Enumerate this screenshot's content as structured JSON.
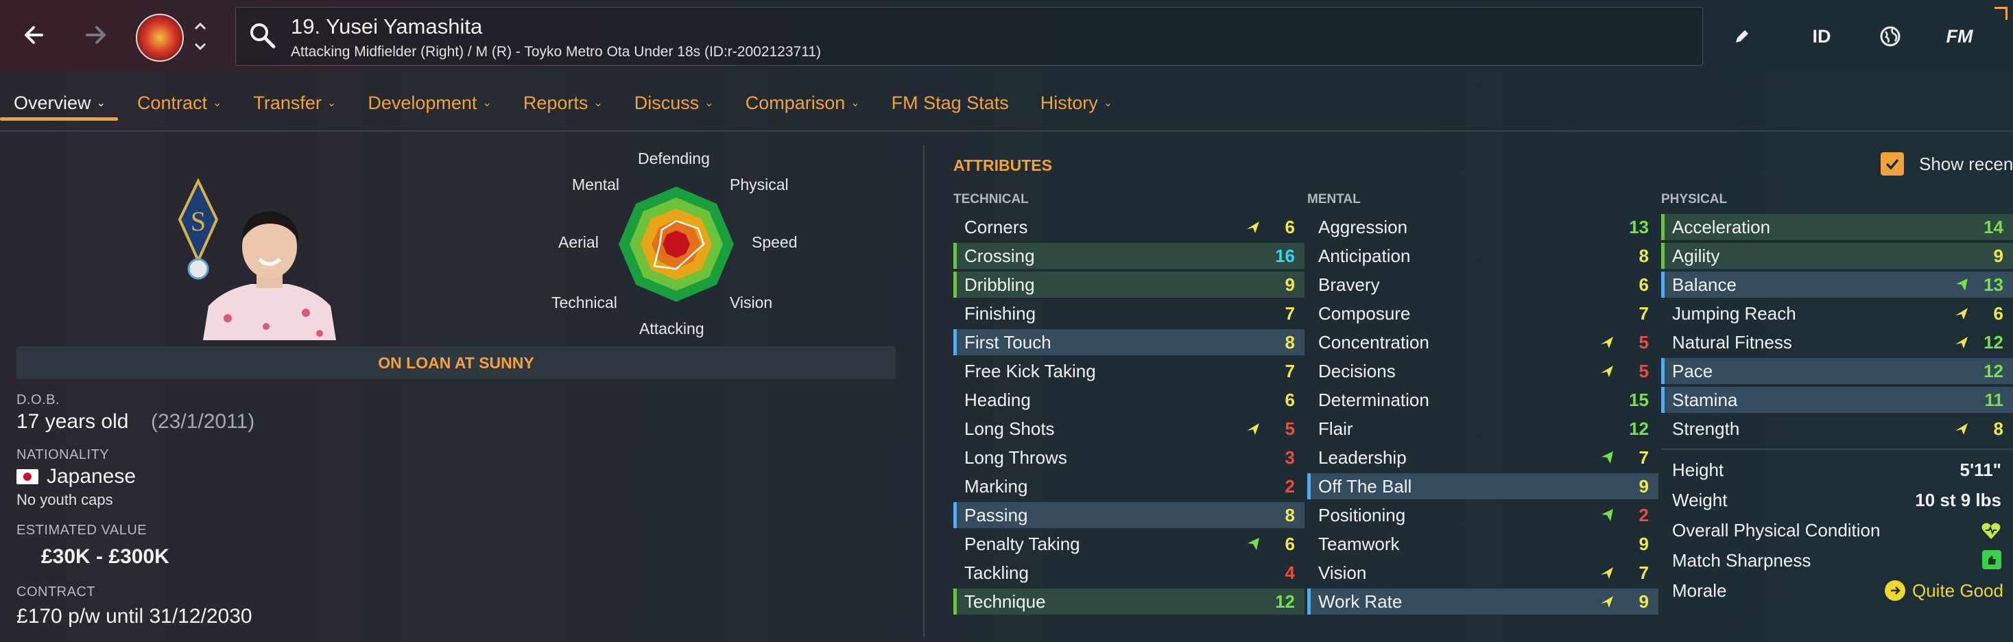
{
  "header": {
    "title": "19. Yusei Yamashita",
    "subtitle": "Attacking Midfielder (Right) / M (R) - Toyko Metro Ota Under 18s (ID:r-2002123711)",
    "icons": [
      "back-arrow-icon",
      "forward-arrow-icon",
      "club-crest-icon",
      "chevron-up-icon",
      "chevron-down-icon",
      "search-icon",
      "pencil-icon",
      "globe-icon"
    ],
    "id_label": "ID",
    "fm_label": "FM"
  },
  "tabs": [
    {
      "label": "Overview",
      "active": true,
      "dropdown": true
    },
    {
      "label": "Contract",
      "dropdown": true
    },
    {
      "label": "Transfer",
      "dropdown": true
    },
    {
      "label": "Development",
      "dropdown": true
    },
    {
      "label": "Reports",
      "dropdown": true
    },
    {
      "label": "Discuss",
      "dropdown": true
    },
    {
      "label": "Comparison",
      "dropdown": true
    },
    {
      "label": "FM Stag Stats",
      "dropdown": false
    },
    {
      "label": "History",
      "dropdown": true
    }
  ],
  "radar": {
    "labels": [
      "Defending",
      "Physical",
      "Speed",
      "Vision",
      "Attacking",
      "Technical",
      "Aerial",
      "Mental"
    ]
  },
  "profile": {
    "loan_status": "ON LOAN AT SUNNY",
    "dob_label": "D.O.B.",
    "age": "17 years old",
    "dob": "(23/1/2011)",
    "nationality_label": "NATIONALITY",
    "nationality": "Japanese",
    "youth_caps": "No youth caps",
    "value_label": "ESTIMATED VALUE",
    "value": "£30K - £300K",
    "contract_label": "CONTRACT",
    "contract": "£170 p/w until 31/12/2030"
  },
  "attributes": {
    "title": "ATTRIBUTES",
    "show_recent_label": "Show recen",
    "show_recent_checked": true,
    "technical_label": "TECHNICAL",
    "mental_label": "MENTAL",
    "physical_label": "PHYSICAL",
    "technical": [
      {
        "name": "Corners",
        "value": "6",
        "arrow": "up"
      },
      {
        "name": "Crossing",
        "value": "16",
        "hl": "green"
      },
      {
        "name": "Dribbling",
        "value": "9",
        "hl": "green"
      },
      {
        "name": "Finishing",
        "value": "7"
      },
      {
        "name": "First Touch",
        "value": "8",
        "hl": "blue"
      },
      {
        "name": "Free Kick Taking",
        "value": "7"
      },
      {
        "name": "Heading",
        "value": "6"
      },
      {
        "name": "Long Shots",
        "value": "5",
        "arrow": "up"
      },
      {
        "name": "Long Throws",
        "value": "3"
      },
      {
        "name": "Marking",
        "value": "2"
      },
      {
        "name": "Passing",
        "value": "8",
        "hl": "blue"
      },
      {
        "name": "Penalty Taking",
        "value": "6",
        "arrow": "down"
      },
      {
        "name": "Tackling",
        "value": "4"
      },
      {
        "name": "Technique",
        "value": "12",
        "hl": "green"
      }
    ],
    "mental": [
      {
        "name": "Aggression",
        "value": "13"
      },
      {
        "name": "Anticipation",
        "value": "8"
      },
      {
        "name": "Bravery",
        "value": "6"
      },
      {
        "name": "Composure",
        "value": "7"
      },
      {
        "name": "Concentration",
        "value": "5",
        "arrow": "up"
      },
      {
        "name": "Decisions",
        "value": "5",
        "arrow": "up"
      },
      {
        "name": "Determination",
        "value": "15"
      },
      {
        "name": "Flair",
        "value": "12"
      },
      {
        "name": "Leadership",
        "value": "7",
        "arrow": "down"
      },
      {
        "name": "Off The Ball",
        "value": "9",
        "hl": "blue"
      },
      {
        "name": "Positioning",
        "value": "2",
        "arrow": "down"
      },
      {
        "name": "Teamwork",
        "value": "9"
      },
      {
        "name": "Vision",
        "value": "7",
        "arrow": "up"
      },
      {
        "name": "Work Rate",
        "value": "9",
        "hl": "blue",
        "arrow": "up"
      }
    ],
    "physical": [
      {
        "name": "Acceleration",
        "value": "14",
        "hl": "green"
      },
      {
        "name": "Agility",
        "value": "9",
        "hl": "green"
      },
      {
        "name": "Balance",
        "value": "13",
        "hl": "blue",
        "arrow": "down"
      },
      {
        "name": "Jumping Reach",
        "value": "6",
        "arrow": "up"
      },
      {
        "name": "Natural Fitness",
        "value": "12",
        "arrow": "up"
      },
      {
        "name": "Pace",
        "value": "12",
        "hl": "blue"
      },
      {
        "name": "Stamina",
        "value": "11",
        "hl": "blue"
      },
      {
        "name": "Strength",
        "value": "8",
        "arrow": "up"
      }
    ],
    "info": {
      "height_label": "Height",
      "height": "5'11\"",
      "weight_label": "Weight",
      "weight": "10 st 9 lbs",
      "condition_label": "Overall Physical Condition",
      "sharpness_label": "Match Sharpness",
      "morale_label": "Morale",
      "morale": "Quite Good"
    }
  },
  "colors": {
    "accent": "#f2a23a",
    "low": "#f14b3e",
    "mid": "#f0e74a",
    "good": "#78e04a",
    "great": "#2fd9f0"
  }
}
